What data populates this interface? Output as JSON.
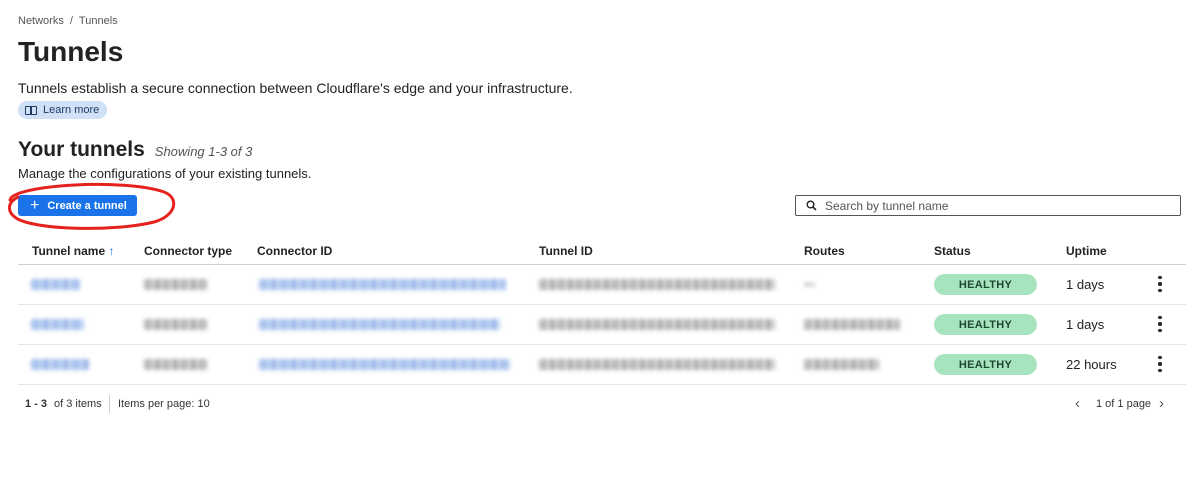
{
  "breadcrumb": {
    "parent": "Networks",
    "separator": "/",
    "current": "Tunnels"
  },
  "page": {
    "title": "Tunnels",
    "description": "Tunnels establish a secure connection between Cloudflare's edge and your infrastructure.",
    "learn_more": "Learn more"
  },
  "section": {
    "title": "Your tunnels",
    "showing": "Showing 1-3 of 3",
    "description": "Manage the configurations of your existing tunnels."
  },
  "actions": {
    "create_label": "Create a tunnel",
    "search_placeholder": "Search by tunnel name"
  },
  "table": {
    "columns": [
      "Tunnel name",
      "Connector type",
      "Connector ID",
      "Tunnel ID",
      "Routes",
      "Status",
      "Uptime"
    ],
    "sort_icon": "arrow-up-icon",
    "rows": [
      {
        "status": "HEALTHY",
        "uptime": "1 days"
      },
      {
        "status": "HEALTHY",
        "uptime": "1 days"
      },
      {
        "status": "HEALTHY",
        "uptime": "22 hours"
      }
    ]
  },
  "pagination": {
    "range": "1 - 3",
    "total": "of 3 items",
    "per_page": "Items per page: 10",
    "page_info": "1 of 1 page"
  },
  "colors": {
    "primary": "#1a73e8",
    "healthy_badge": "#a8e3c0",
    "annotation": "#e5211d"
  }
}
